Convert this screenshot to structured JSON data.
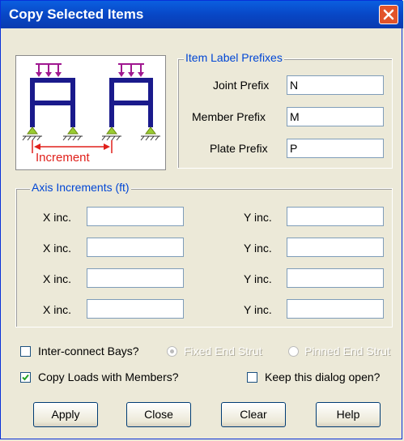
{
  "title": "Copy Selected Items",
  "picture": {
    "caption": "Increment"
  },
  "prefixes": {
    "legend": "Item Label Prefixes",
    "joint_label": "Joint Prefix",
    "joint_value": "N",
    "member_label": "Member Prefix",
    "member_value": "M",
    "plate_label": "Plate Prefix",
    "plate_value": "P"
  },
  "axis": {
    "legend": "Axis Increments  (ft)",
    "rows": [
      {
        "x_label": "X inc.",
        "x_value": "",
        "y_label": "Y inc.",
        "y_value": ""
      },
      {
        "x_label": "X inc.",
        "x_value": "",
        "y_label": "Y inc.",
        "y_value": ""
      },
      {
        "x_label": "X inc.",
        "x_value": "",
        "y_label": "Y inc.",
        "y_value": ""
      },
      {
        "x_label": "X inc.",
        "x_value": "",
        "y_label": "Y inc.",
        "y_value": ""
      }
    ]
  },
  "options": {
    "interconnect_label": "Inter-connect Bays?",
    "interconnect_checked": false,
    "fixed_label": "Fixed End Strut",
    "pinned_label": "Pinned End Strut",
    "copy_loads_label": "Copy Loads with Members?",
    "copy_loads_checked": true,
    "keep_open_label": "Keep this dialog open?",
    "keep_open_checked": false
  },
  "buttons": {
    "apply": "Apply",
    "close": "Close",
    "clear": "Clear",
    "help": "Help"
  },
  "colors": {
    "frame": "#1a1a8c",
    "load": "#a01890",
    "support": "#9acd32",
    "increment": "#e0201b",
    "legend": "#0046d5"
  }
}
